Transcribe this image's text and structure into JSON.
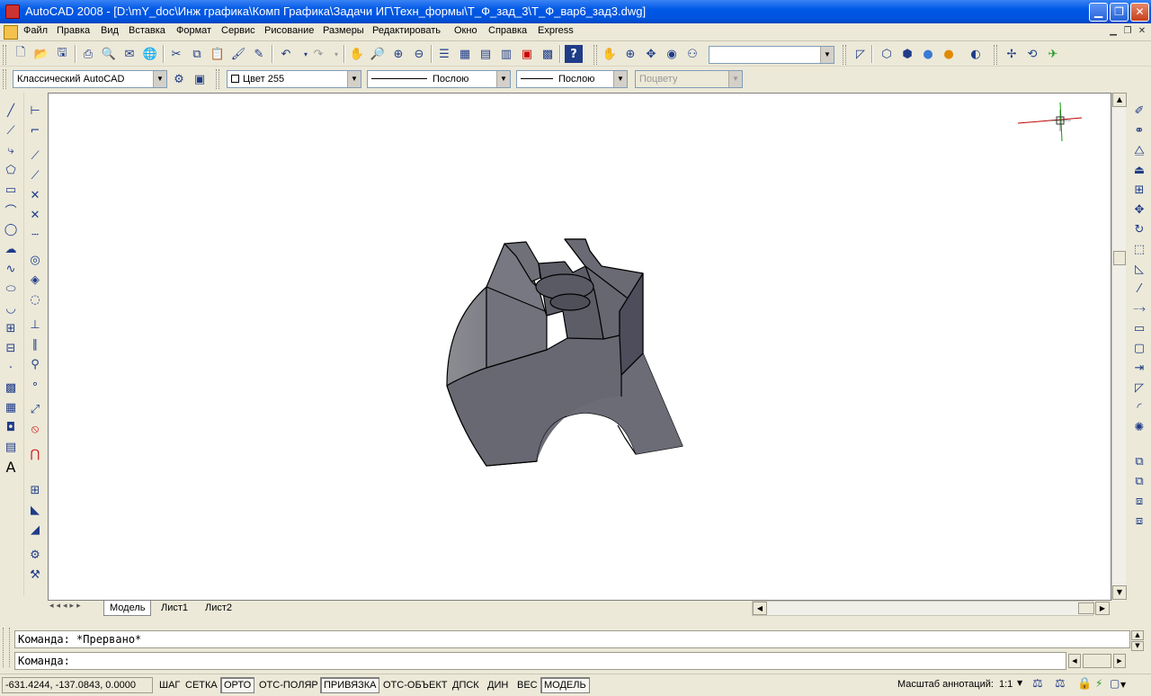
{
  "window": {
    "title": "AutoCAD 2008 - [D:\\mY_doc\\Инж графика\\Комп Графика\\Задачи ИГ\\Техн_формы\\Т_Ф_зад_3\\Т_Ф_вар6_зад3.dwg]",
    "controls": [
      "minimize",
      "restore",
      "close"
    ]
  },
  "menu": {
    "items": [
      "Файл",
      "Правка",
      "Вид",
      "Вставка",
      "Формат",
      "Сервис",
      "Рисование",
      "Размеры",
      "Редактировать",
      "Окно",
      "Справка",
      "Express"
    ]
  },
  "toolbar_styles": {
    "workspace": "Классический AutoCAD",
    "color": "Цвет 255",
    "linetype": "Послою",
    "lineweight": "Послою",
    "plotstyle": "Поцвету",
    "view_combo": ""
  },
  "tabs": {
    "items": [
      "Модель",
      "Лист1",
      "Лист2"
    ],
    "active": "Модель"
  },
  "command": {
    "history": "Команда: *Прервано*",
    "prompt": "Команда:"
  },
  "status": {
    "coordinates": "-631.4244, -137.0843, 0.0000",
    "toggles": [
      {
        "label": "ШАГ",
        "on": false
      },
      {
        "label": "СЕТКА",
        "on": false
      },
      {
        "label": "ОРТО",
        "on": true
      },
      {
        "label": "ОТС-ПОЛЯР",
        "on": false
      },
      {
        "label": "ПРИВЯЗКА",
        "on": true
      },
      {
        "label": "ОТС-ОБЪЕКТ",
        "on": false
      },
      {
        "label": "ДПСК",
        "on": false
      },
      {
        "label": "ДИН",
        "on": false
      },
      {
        "label": "ВЕС",
        "on": false
      },
      {
        "label": "МОДЕЛЬ",
        "on": true
      }
    ],
    "annotation_scale_label": "Масштаб аннотаций:",
    "annotation_scale_value": "1:1"
  },
  "colors": {
    "titlebar": "#0054de",
    "model_fill": "#6a6a75",
    "ucs_x": "#c00000",
    "ucs_y": "#00a000"
  }
}
